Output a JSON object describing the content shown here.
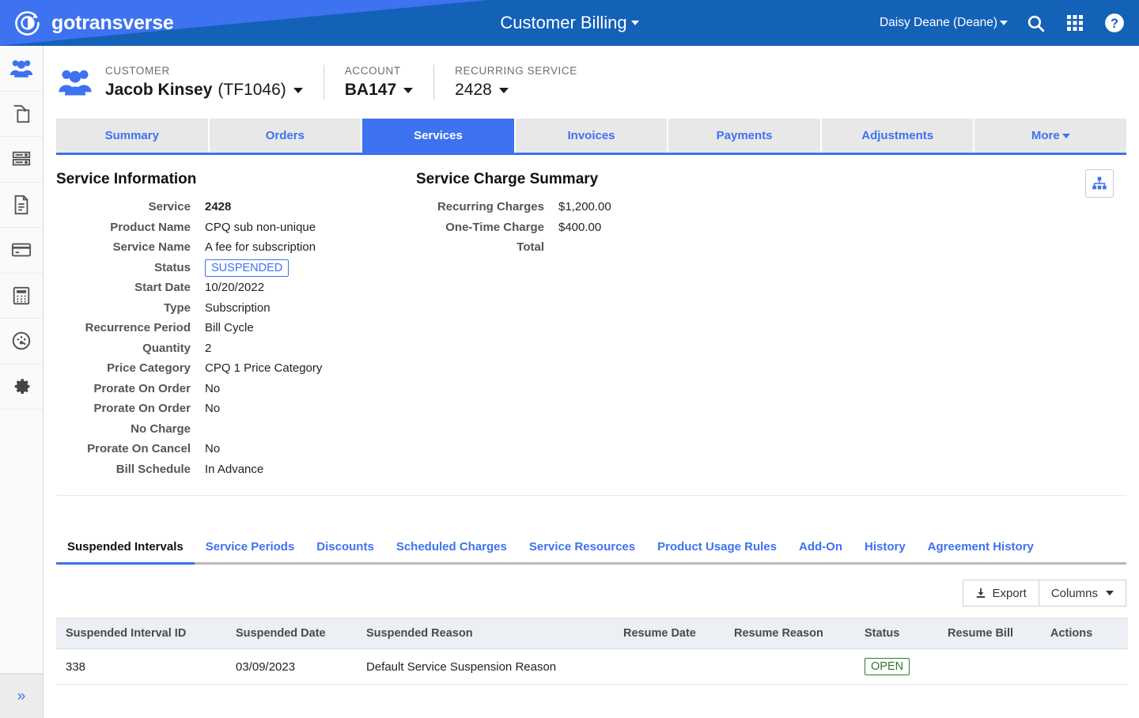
{
  "header": {
    "brand": "gotransverse",
    "brand_logo_icon": "circle-arrow-logo-icon",
    "title": "Customer Billing",
    "user": "Daisy Deane (Deane)",
    "icons": [
      "search-icon",
      "apps-grid-icon",
      "help-circle-icon"
    ],
    "colors": {
      "dark_blue": "#1461b8",
      "light_blue": "#3d72f0"
    }
  },
  "sidebar": {
    "items": [
      {
        "icon": "customers-people-icon",
        "active": true
      },
      {
        "icon": "products-copy-icon",
        "active": false
      },
      {
        "icon": "database-server-icon",
        "active": false
      },
      {
        "icon": "document-page-icon",
        "active": false
      },
      {
        "icon": "credit-card-icon",
        "active": false
      },
      {
        "icon": "calculator-icon",
        "active": false
      },
      {
        "icon": "dashboard-gauge-icon",
        "active": false
      },
      {
        "icon": "settings-gear-icon",
        "active": false
      }
    ],
    "expand_label": "»",
    "expand_icon": "chevron-double-right-icon"
  },
  "context": {
    "avatar_icon": "customer-group-icon",
    "customer": {
      "label": "CUSTOMER",
      "value_bold": "Jacob Kinsey",
      "value_light": "(TF1046)"
    },
    "account": {
      "label": "ACCOUNT",
      "value_bold": "BA147",
      "value_light": ""
    },
    "recurring_service": {
      "label": "RECURRING SERVICE",
      "value_bold": "",
      "value_light": "2428"
    }
  },
  "tabs": [
    {
      "label": "Summary",
      "active": false
    },
    {
      "label": "Orders",
      "active": false
    },
    {
      "label": "Services",
      "active": true
    },
    {
      "label": "Invoices",
      "active": false
    },
    {
      "label": "Payments",
      "active": false
    },
    {
      "label": "Adjustments",
      "active": false
    },
    {
      "label": "More",
      "active": false,
      "has_caret": true
    }
  ],
  "service_information": {
    "title": "Service Information",
    "fields": [
      {
        "label": "Service",
        "value": "2428",
        "bold": true
      },
      {
        "label": "Product Name",
        "value": "CPQ sub non-unique"
      },
      {
        "label": "Service Name",
        "value": "A fee for subscription"
      },
      {
        "label": "Status",
        "value": "SUSPENDED",
        "badge": "suspended"
      },
      {
        "label": "Start Date",
        "value": "10/20/2022"
      },
      {
        "label": "Type",
        "value": "Subscription"
      },
      {
        "label": "Recurrence Period",
        "value": "Bill Cycle"
      },
      {
        "label": "Quantity",
        "value": "2"
      },
      {
        "label": "Price Category",
        "value": "CPQ 1 Price Category"
      },
      {
        "label": "Prorate On Order",
        "value": "No"
      },
      {
        "label": "Prorate On Order",
        "value": "No"
      },
      {
        "label": "No Charge",
        "value": ""
      },
      {
        "label": "Prorate On Cancel",
        "value": "No"
      },
      {
        "label": "Bill Schedule",
        "value": "In Advance"
      }
    ]
  },
  "service_charge_summary": {
    "title": "Service Charge Summary",
    "fields": [
      {
        "label": "Recurring Charges",
        "value": "$1,200.00"
      },
      {
        "label": "One-Time Charge",
        "value": "$400.00"
      },
      {
        "label": "Total",
        "value": ""
      }
    ]
  },
  "hierarchy_button": {
    "icon": "org-hierarchy-icon",
    "color": "#3d72f0"
  },
  "subtabs": [
    {
      "label": "Suspended Intervals",
      "active": true
    },
    {
      "label": "Service Periods",
      "active": false
    },
    {
      "label": "Discounts",
      "active": false
    },
    {
      "label": "Scheduled Charges",
      "active": false
    },
    {
      "label": "Service Resources",
      "active": false
    },
    {
      "label": "Product Usage Rules",
      "active": false
    },
    {
      "label": "Add-On",
      "active": false
    },
    {
      "label": "History",
      "active": false
    },
    {
      "label": "Agreement History",
      "active": false
    }
  ],
  "table_toolbar": {
    "export_label": "Export",
    "export_icon": "download-export-icon",
    "columns_label": "Columns",
    "columns_icon": "chevron-down-icon"
  },
  "table": {
    "columns": [
      "Suspended Interval ID",
      "Suspended Date",
      "Suspended Reason",
      "Resume Date",
      "Resume Reason",
      "Status",
      "Resume Bill",
      "Actions"
    ],
    "rows": [
      {
        "suspended_interval_id": "338",
        "suspended_date": "03/09/2023",
        "suspended_reason": "Default Service Suspension Reason",
        "resume_date": "",
        "resume_reason": "",
        "status": "OPEN",
        "resume_bill": "",
        "actions": ""
      }
    ]
  }
}
